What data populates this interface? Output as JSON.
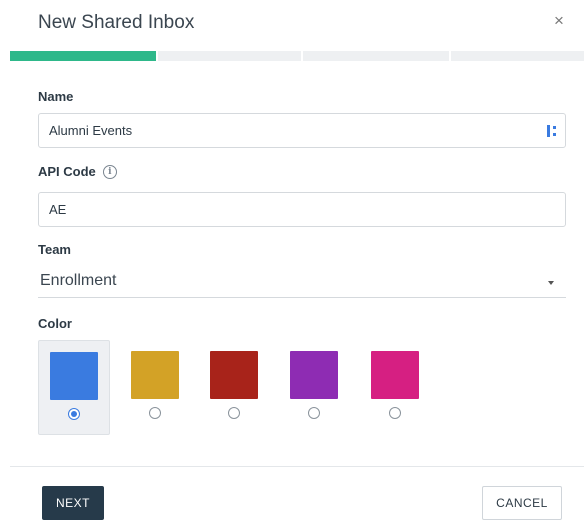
{
  "dialog": {
    "title": "New Shared Inbox",
    "close_glyph": "×",
    "close_icon": "close-icon"
  },
  "progress": {
    "steps_total": 4,
    "current_step": 1,
    "active_color": "#2eb88a"
  },
  "form": {
    "name": {
      "label": "Name",
      "value": "Alumni Events",
      "field_icon": "extension-icon"
    },
    "api_code": {
      "label": "API Code",
      "value": "AE",
      "info_icon": "info-icon",
      "info_glyph": "i"
    },
    "team": {
      "label": "Team",
      "value": "Enrollment",
      "caret_icon": "caret-down-icon"
    },
    "color": {
      "label": "Color",
      "options": [
        {
          "hex": "#3a7be0",
          "selected": true
        },
        {
          "hex": "#d3a226",
          "selected": false
        },
        {
          "hex": "#a8231a",
          "selected": false
        },
        {
          "hex": "#8e2cb3",
          "selected": false
        },
        {
          "hex": "#d61f82",
          "selected": false
        }
      ]
    }
  },
  "footer": {
    "next_label": "NEXT",
    "cancel_label": "CANCEL"
  }
}
